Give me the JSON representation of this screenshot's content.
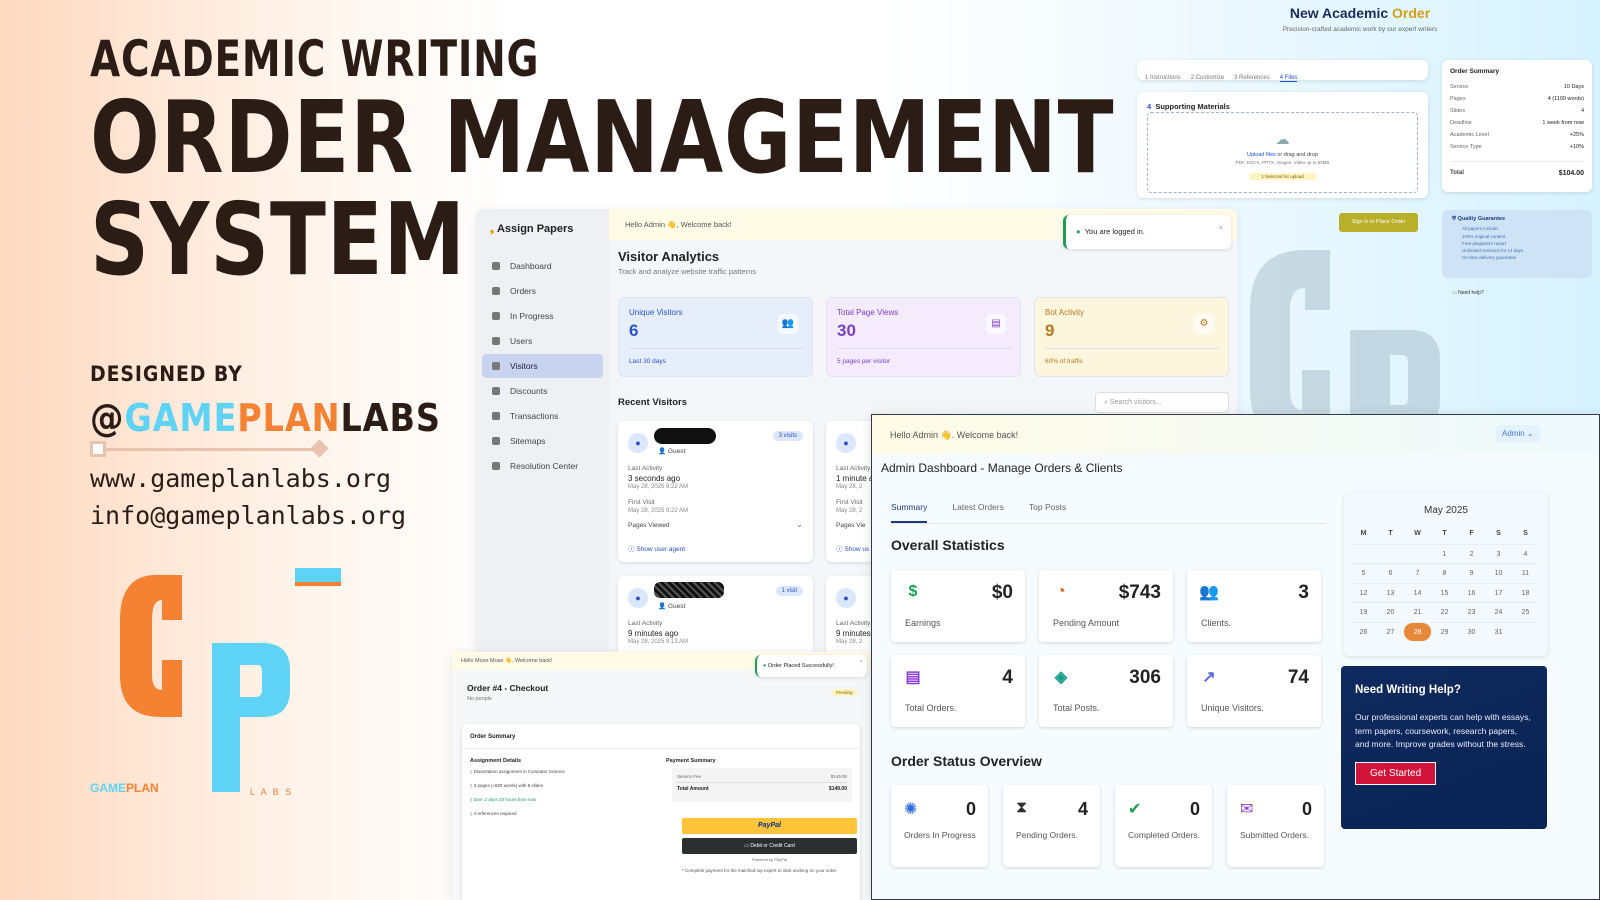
{
  "hero": {
    "subtitle": "ACADEMIC WRITING",
    "title_line1": "ORDER MANAGEMENT",
    "title_line2": "SYSTEM",
    "designed_by": "DESIGNED BY",
    "handle_at": "@",
    "handle_game": "GAME",
    "handle_plan": "PLAN",
    "handle_labs": "LABS",
    "website": "www.gameplanlabs.org",
    "email": "info@gameplanlabs.org"
  },
  "logo": {
    "brand_game": "GAME",
    "brand_plan": "PLAN",
    "labs": "L A B S",
    "colors": {
      "orange": "#f58233",
      "blue": "#5fd3f5",
      "dark": "#2b1d16"
    }
  },
  "new_order": {
    "title_prefix": "New Academic",
    "title_highlight": "Order",
    "subtitle": "Precision-crafted academic work by our expert writers",
    "steps": [
      "1 Instructions",
      "2 Customize",
      "3 References",
      "4 Files"
    ],
    "section_num": "4",
    "section_title": "Supporting Materials",
    "upload_link": "Upload files",
    "upload_text": " or drag and drop",
    "upload_types": "PDF, DOCX, PPTX, Images, Video up to 50MB",
    "upload_status": "1 Selected for upload",
    "summary_title": "Order Summary",
    "summary": [
      {
        "k": "Service",
        "v": "10 Days"
      },
      {
        "k": "Pages",
        "v": "4 (1100 words)"
      },
      {
        "k": "Slides",
        "v": "4"
      },
      {
        "k": "Deadline",
        "v": "1 week from now"
      },
      {
        "k": "Academic Level",
        "v": "+25%"
      },
      {
        "k": "Service Type",
        "v": "+10%"
      }
    ],
    "total_label": "Total",
    "total_value": "$104.00",
    "signin_btn": "Sign in to Place Order",
    "guarantee_title": "Quality Guarantee",
    "guarantee_intro": "All papers include:",
    "guarantee_items": [
      "100% original content",
      "Free plagiarism report",
      "Unlimited revisions for 14 days",
      "On-time delivery guarantee"
    ],
    "need_help": "Need help?"
  },
  "visitors": {
    "brand": "Assign Papers",
    "welcome": "Hello Admin 👋, Welcome back!",
    "toast": "You are logged in.",
    "title": "Visitor Analytics",
    "subtitle": "Track and analyze website traffic patterns",
    "sidebar": [
      {
        "label": "Dashboard"
      },
      {
        "label": "Orders"
      },
      {
        "label": "In Progress"
      },
      {
        "label": "Users"
      },
      {
        "label": "Visitors"
      },
      {
        "label": "Discounts"
      },
      {
        "label": "Transactions"
      },
      {
        "label": "Sitemaps"
      },
      {
        "label": "Resolution Center"
      }
    ],
    "stats": [
      {
        "label": "Unique Visitors",
        "value": "6",
        "foot": "Last 30 days",
        "color": "#2952c7"
      },
      {
        "label": "Total Page Views",
        "value": "30",
        "foot": "5 pages per visitor",
        "color": "#7b3fc4"
      },
      {
        "label": "Bot Activity",
        "value": "9",
        "foot": "60% of traffic",
        "color": "#b7791f"
      }
    ],
    "recent_title": "Recent Visitors",
    "search_placeholder": "Search visitors...",
    "cards": [
      {
        "badge": "3 visits",
        "role": "Guest",
        "last_label": "Last Activity",
        "last": "3 seconds ago",
        "last_date": "May 28, 2025 9:22 AM",
        "first_label": "First Visit",
        "first_date": "May 28, 2025 9:22 AM",
        "pages": "Pages Viewed",
        "agent": "Show user agent"
      },
      {
        "badge": "1 visit",
        "role": "Guest",
        "last_label": "Last Activity",
        "last": "9 minutes ago",
        "last_date": "May 28, 2025 9:13 AM"
      }
    ],
    "cards_right": [
      {
        "last_label": "Last Activity",
        "last": "1 minute a",
        "last_date": "May 28, 2",
        "first_label": "First Visit",
        "first_date": "May 28, 2",
        "pages": "Pages Vie",
        "agent": "Show us"
      },
      {
        "last_label": "Last Activity",
        "last": "9 minutes",
        "last_date": "May 28, 2"
      }
    ]
  },
  "checkout": {
    "welcome": "Hello Mose Muse 👋, Welcome back!",
    "toast": "Order Placed Successfully!",
    "title": "Order #4 - Checkout",
    "people": "No people",
    "status": "Pending",
    "summary": "Order Summary",
    "assign_title": "Assignment Details",
    "assign_items": [
      "Dissertation assignment in Computer Science",
      "3 pages (≈825 words) with 6 slides",
      "Due: 2 days 23 hours from now",
      "4 references required"
    ],
    "pay_title": "Payment Summary",
    "fee_label": "Service Fee",
    "fee": "$149.00",
    "total_label": "Total Amount",
    "total": "$149.00",
    "paypal": "PayPal",
    "card_btn": "Debit or Credit Card",
    "powered": "Powered by PayPal",
    "note": "* Complete payment for the matched top expert to start working on your order"
  },
  "admin": {
    "welcome": "Hello Admin 👋. Welcome back!",
    "admin_btn": "Admin ⌄",
    "title": "Admin Dashboard - Manage Orders & Clients",
    "tabs": [
      "Summary",
      "Latest Orders",
      "Top Posts"
    ],
    "overall": "Overall Statistics",
    "stats": [
      {
        "icon": "$",
        "value": "$0",
        "label": "Earnings",
        "color": "#1f9d55"
      },
      {
        "icon": "◔",
        "value": "$743",
        "label": "Pending Amount",
        "color": "#e05a1c"
      },
      {
        "icon": "👥",
        "value": "3",
        "label": "Clients.",
        "color": "#2b6cdf"
      },
      {
        "icon": "▤",
        "value": "4",
        "label": "Total Orders.",
        "color": "#8b3fd1"
      },
      {
        "icon": "◈",
        "value": "306",
        "label": "Total Posts.",
        "color": "#119d8a"
      },
      {
        "icon": "↗",
        "value": "74",
        "label": "Unique Visitors.",
        "color": "#5a67d8"
      }
    ],
    "status_title": "Order Status Overview",
    "status": [
      {
        "icon": "✺",
        "value": "0",
        "label": "Orders In Progress",
        "color": "#2b6cdf"
      },
      {
        "icon": "⧗",
        "value": "4",
        "label": "Pending Orders.",
        "color": "#333"
      },
      {
        "icon": "✔",
        "value": "0",
        "label": "Completed Orders.",
        "color": "#1f9d55"
      },
      {
        "icon": "✉",
        "value": "0",
        "label": "Submitted Orders.",
        "color": "#8b3fd1"
      }
    ]
  },
  "calendar": {
    "month": "May 2025",
    "days": [
      "M",
      "T",
      "W",
      "T",
      "F",
      "S",
      "S"
    ],
    "cells": [
      "",
      "",
      "",
      "1",
      "2",
      "3",
      "4",
      "5",
      "6",
      "7",
      "8",
      "9",
      "10",
      "11",
      "12",
      "13",
      "14",
      "15",
      "16",
      "17",
      "18",
      "19",
      "20",
      "21",
      "22",
      "23",
      "24",
      "25",
      "26",
      "27",
      "28",
      "29",
      "30",
      "31",
      ""
    ],
    "selected": "28"
  },
  "help": {
    "title": "Need Writing Help?",
    "text": "Our professional experts can help with essays, term papers, coursework, research papers, and more. Improve grades without the stress.",
    "button": "Get Started"
  }
}
